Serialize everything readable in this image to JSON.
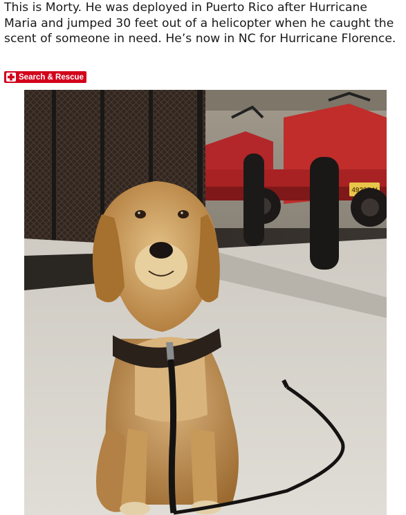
{
  "post": {
    "title": "This is Morty. He was deployed in Puerto Rico after Hurricane Maria and jumped 30 feet out of a helicopter when he caught the scent of someone in need. He’s now in NC for Hurricane Florence.",
    "flair": {
      "label": "Search & Rescue",
      "icon": "red-cross-icon",
      "background_color": "#d3021b",
      "text_color": "#ffffff"
    },
    "image": {
      "plate_text": "49235 V"
    }
  }
}
